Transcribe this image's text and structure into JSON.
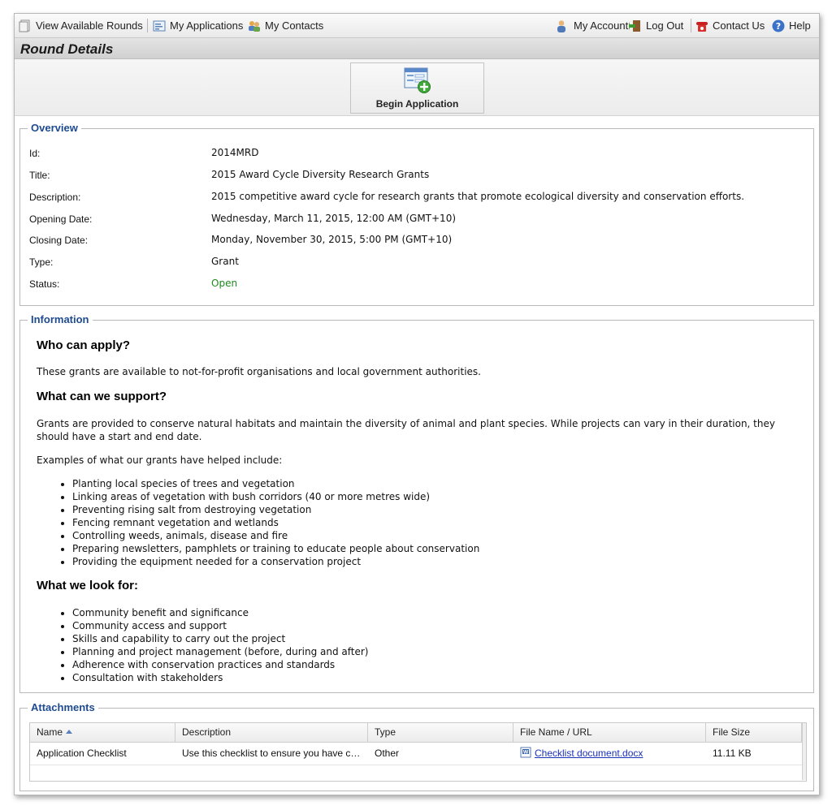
{
  "nav": {
    "left": [
      {
        "label": "View Available Rounds",
        "icon": "pages-icon"
      },
      {
        "label": "My Applications",
        "icon": "form-icon"
      },
      {
        "label": "My Contacts",
        "icon": "contacts-icon"
      }
    ],
    "right": [
      {
        "label": "My Account",
        "icon": "user-icon"
      },
      {
        "label": "Log Out",
        "icon": "door-exit-icon"
      },
      {
        "label": "Contact Us",
        "icon": "telephone-icon"
      },
      {
        "label": "Help",
        "icon": "help-icon"
      }
    ]
  },
  "page_title": "Round Details",
  "toolbar": {
    "begin_label": "Begin Application"
  },
  "overview": {
    "legend": "Overview",
    "fields": [
      {
        "label": "Id:",
        "value": "2014MRD"
      },
      {
        "label": "Title:",
        "value": "2015 Award Cycle Diversity Research Grants"
      },
      {
        "label": "Description:",
        "value": "2015 competitive award cycle for research grants that promote ecological diversity and conservation efforts."
      },
      {
        "label": "Opening Date:",
        "value": "Wednesday, March 11, 2015, 12:00 AM (GMT+10)"
      },
      {
        "label": "Closing Date:",
        "value": "Monday, November 30, 2015, 5:00 PM (GMT+10)"
      },
      {
        "label": "Type:",
        "value": "Grant"
      },
      {
        "label": "Status:",
        "value": "Open"
      }
    ],
    "status_color": "#1c8a1c"
  },
  "information": {
    "legend": "Information",
    "h1": "Who can apply?",
    "p1": "These grants are available to not-for-profit organisations and local government authorities.",
    "h2": "What can we support?",
    "p2": "Grants are provided to conserve natural habitats and maintain the diversity of animal and plant species. While projects can vary in their duration, they should have a start and end date.",
    "p3": "Examples of what our grants have helped include:",
    "list1": [
      "Planting local species of trees and vegetation",
      "Linking areas of vegetation with bush corridors (40 or more metres wide)",
      "Preventing rising salt from destroying vegetation",
      "Fencing remnant vegetation and wetlands",
      "Controlling weeds, animals, disease and fire",
      "Preparing newsletters, pamphlets or training to educate people about conservation",
      "Providing the equipment needed for a conservation project"
    ],
    "h3": "What we look for:",
    "list2": [
      "Community benefit and significance",
      "Community access and support",
      "Skills and capability to carry out the project",
      "Planning and project management (before, during and after)",
      "Adherence with conservation practices and standards",
      "Consultation with stakeholders"
    ]
  },
  "attachments": {
    "legend": "Attachments",
    "columns": [
      "Name",
      "Description",
      "Type",
      "File Name / URL",
      "File Size"
    ],
    "sorted_column": "Name",
    "rows": [
      {
        "name": "Application Checklist",
        "description": "Use this checklist to ensure you have c…",
        "type": "Other",
        "file": "Checklist document.docx",
        "size": "11.11 KB"
      }
    ]
  },
  "colors": {
    "legend": "#1e4b8f",
    "link": "#1a32b8",
    "status_open": "#1c8a1c"
  }
}
